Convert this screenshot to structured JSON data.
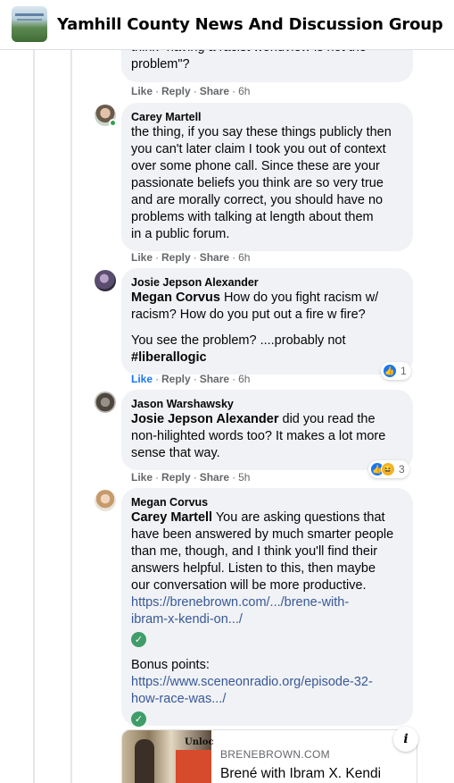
{
  "header": {
    "title": "Yamhill County News And Discussion Group"
  },
  "actions": {
    "like": "Like",
    "reply": "Reply",
    "share": "Share"
  },
  "comments": [
    {
      "lines": [
        "think \"having a racist worldview is not the",
        "problem\"?"
      ],
      "time": "6h"
    },
    {
      "author": "Carey Martell",
      "lines": [
        "the thing, if you say these things publicly then",
        "you can't later claim I took you out of context",
        "over some phone call. Since these are your",
        "passionate beliefs you think are so very true",
        "and are morally correct, you should have no",
        "problems with talking at length about them",
        "in a public forum."
      ],
      "time": "6h"
    },
    {
      "author": "Josie Jepson Alexander",
      "mention": "Megan Corvus",
      "line1_rest": " How do you fight racism w/",
      "line2": "racism? How do you put out a fire w fire?",
      "line3": "You see the problem? ....probably not",
      "hashtag": "#liberallogic",
      "time": "6h",
      "reaction_count": "1"
    },
    {
      "author": "Jason Warshawsky",
      "mention": "Josie Jepson Alexander",
      "line1_rest": " did you read the",
      "line2": "non-hilighted words too? It makes a lot more",
      "line3": "sense that way.",
      "time": "5h",
      "reaction_count": "3"
    },
    {
      "author": "Megan Corvus",
      "mention": "Carey Martell",
      "line1_rest": " You are asking questions that",
      "lines": [
        "have been answered by much smarter people",
        "than me, though, and I think you'll find their",
        "answers helpful. Listen to this, then maybe",
        "our conversation will be more productive."
      ],
      "link1": [
        "https://brenebrown.com/.../brene-with-",
        "ibram-x-kendi-on.../"
      ],
      "bonus": "Bonus points:",
      "link2": [
        "https://www.sceneonradio.org/episode-32-",
        "how-race-was.../"
      ]
    }
  ],
  "card": {
    "domain": "BRENEBROWN.COM",
    "title": "Brené with Ibram X. Kendi",
    "image_text": "Unloc"
  },
  "icons": {
    "like": "thumbs-up-icon",
    "haha": "laughing-face-icon",
    "verified": "check-icon",
    "info": "info-icon"
  },
  "colors": {
    "link": "#385898",
    "like_blue": "#1877f2",
    "bubble": "#f0f2f5",
    "meta": "#65676b"
  }
}
